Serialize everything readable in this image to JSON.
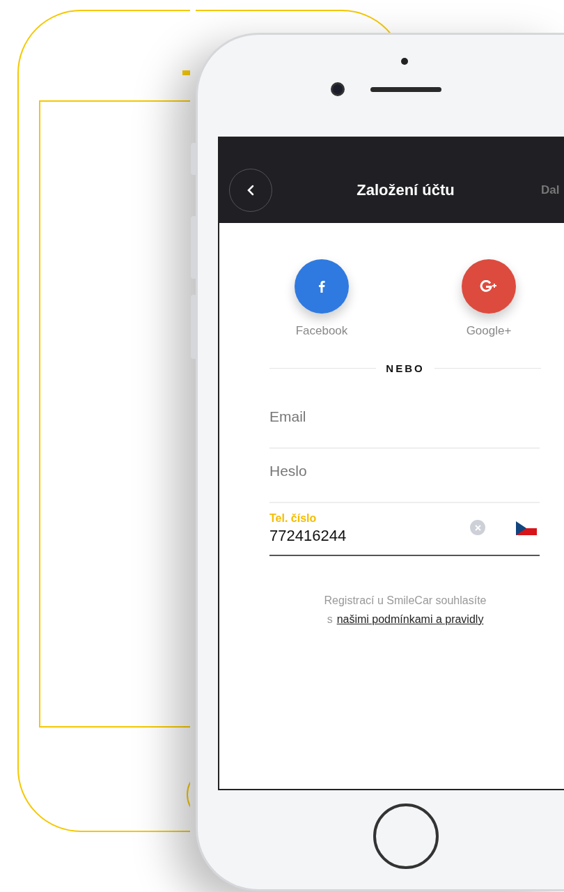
{
  "header": {
    "title": "Založení účtu",
    "next_label": "Dal"
  },
  "social": [
    {
      "kind": "facebook",
      "label": "Facebook"
    },
    {
      "kind": "google",
      "label": "Google+"
    }
  ],
  "divider_label": "NEBO",
  "fields": [
    {
      "kind": "text",
      "placeholder": "Email"
    },
    {
      "kind": "text",
      "placeholder": "Heslo"
    },
    {
      "kind": "phone",
      "label": "Tel. číslo",
      "value": "772416244"
    }
  ],
  "terms": {
    "text": "Registrací u SmileCar souhlasíte",
    "prefix": "s",
    "link": "našimi podmínkami a pravidly"
  }
}
